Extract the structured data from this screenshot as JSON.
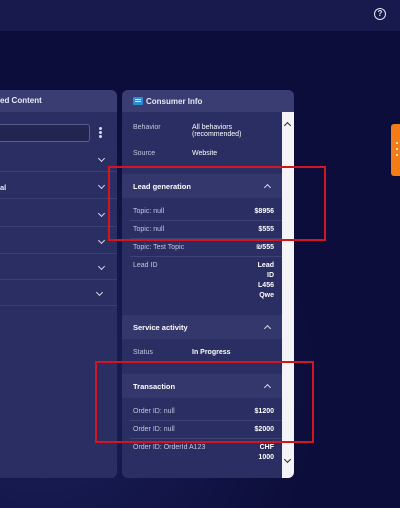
{
  "left_panel": {
    "title": "ed Content",
    "rows": [
      {
        "label": ""
      },
      {
        "label": "al"
      },
      {
        "label": ""
      },
      {
        "label": ""
      },
      {
        "label": ""
      },
      {
        "label": ""
      }
    ]
  },
  "consumer_info": {
    "title": "Consumer Info",
    "behavior_label": "Behavior",
    "behavior_value": "All behaviors (recommended)",
    "source_label": "Source",
    "source_value": "Website",
    "lead_generation": {
      "title": "Lead generation",
      "rows": [
        {
          "label": "Topic: null",
          "value": "$8956"
        },
        {
          "label": "Topic: null",
          "value": "$555"
        },
        {
          "label": "Topic: Test Topic",
          "value": "₪555"
        }
      ],
      "lead_id_label": "Lead ID",
      "lead_id_value": [
        "Lead",
        "ID",
        "L456",
        "Qwe"
      ]
    },
    "service_activity": {
      "title": "Service activity",
      "status_label": "Status",
      "status_value": "In Progress"
    },
    "transaction": {
      "title": "Transaction",
      "rows": [
        {
          "label": "Order ID: null",
          "value": "$1200"
        },
        {
          "label": "Order ID: null",
          "value": "$2000"
        },
        {
          "label": "Order ID: OrderId A123",
          "value": "CHF"
        }
      ],
      "extra_value": "1000"
    }
  },
  "colors": {
    "background": "#0c0d3a",
    "panel": "#2b2e62",
    "highlight": "#d2161f",
    "accent_tab": "#f47c16"
  },
  "icons": [
    "help-icon",
    "consumer-info-icon",
    "kebab-menu-icon",
    "chevron-down-icon",
    "chevron-up-icon"
  ]
}
